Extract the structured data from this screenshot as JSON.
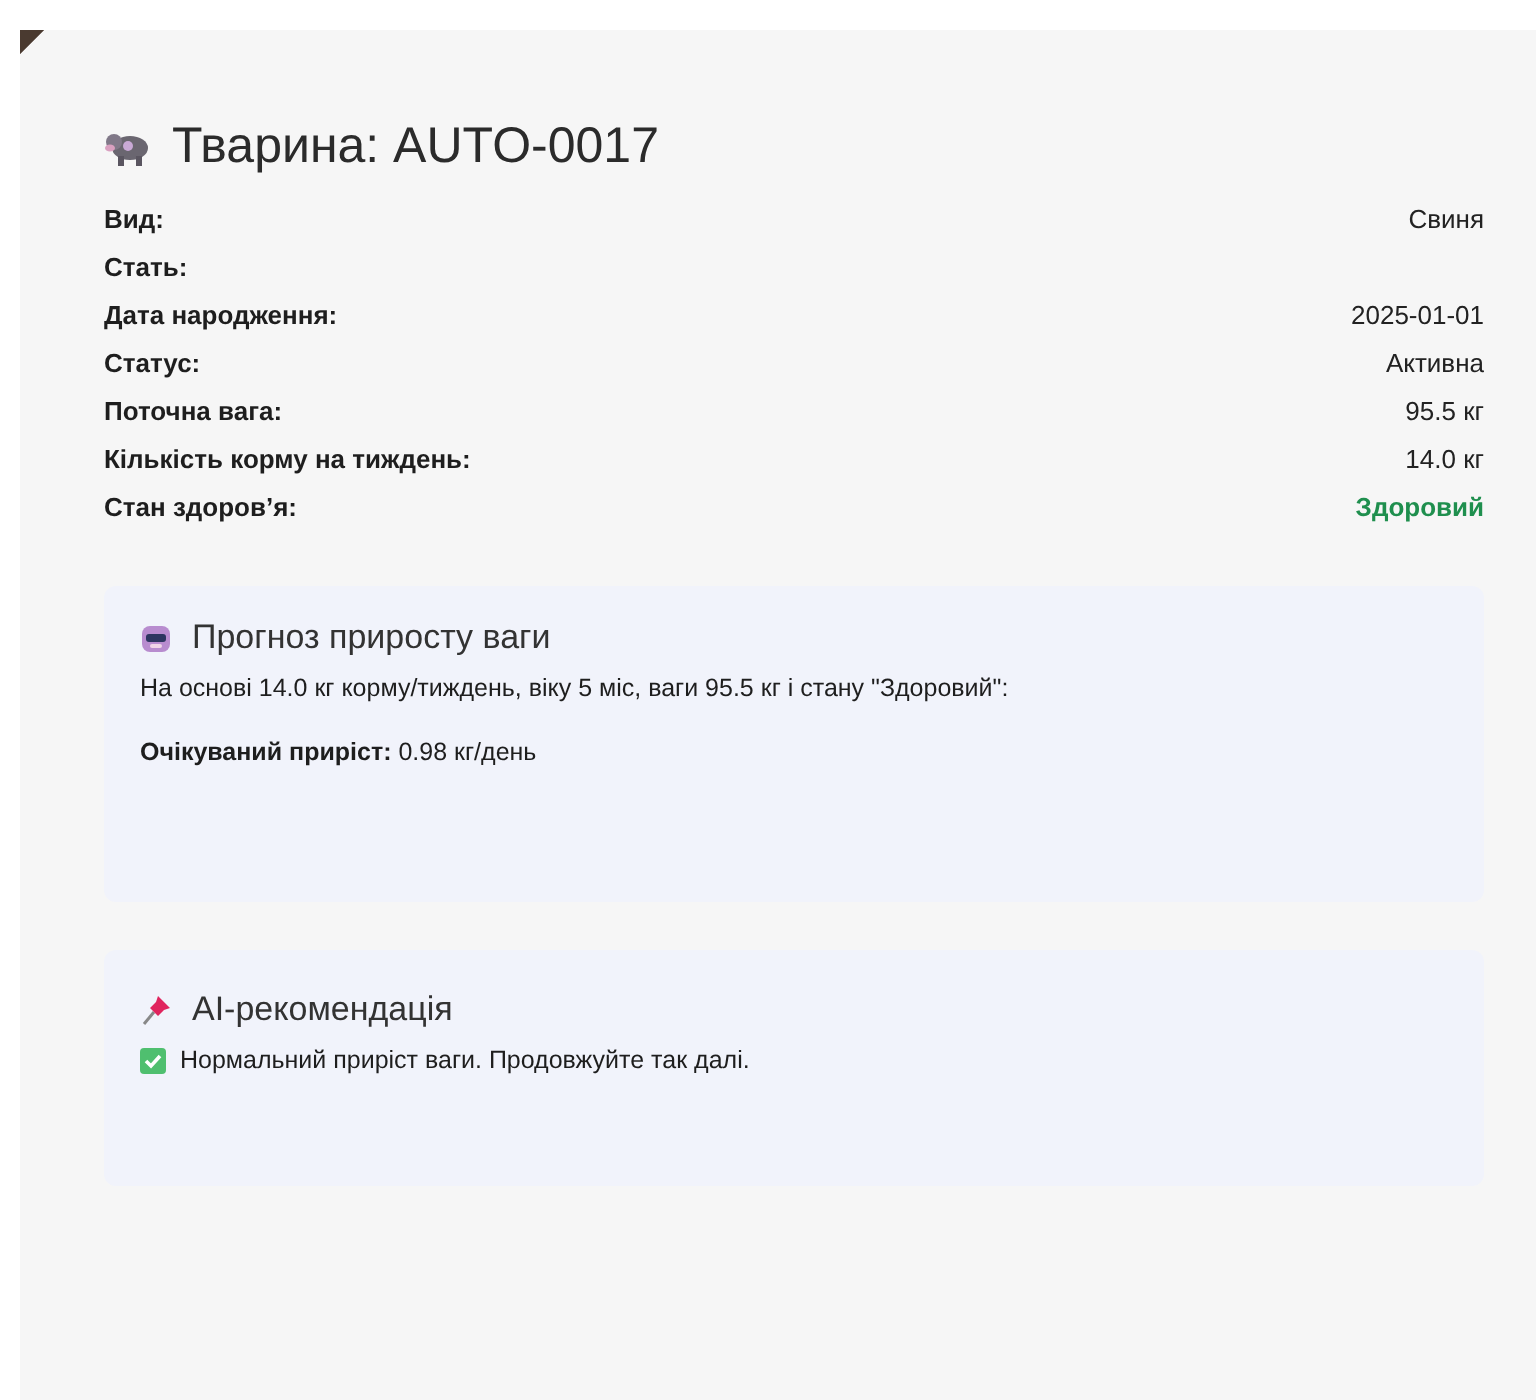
{
  "title": "Тварина: AUTO-0017",
  "details": [
    {
      "label": "Вид:",
      "value": "Свиня",
      "kind": "plain"
    },
    {
      "label": "Стать:"
    },
    {
      "label": "Дата народження:",
      "value": "2025-01-01",
      "kind": "plain"
    },
    {
      "label": "Статус:",
      "value": "Активна",
      "kind": "plain"
    },
    {
      "label": "Поточна вага:",
      "value": "95.5 кг",
      "kind": "plain"
    },
    {
      "label": "Кількість корму на тиждень:",
      "value": "14.0 кг",
      "kind": "plain"
    },
    {
      "label": "Стан здоров’я:",
      "value": "Здоровий",
      "kind": "good"
    }
  ],
  "forecast": {
    "title": "Прогноз приросту ваги",
    "basis": "На основі 14.0 кг корму/тиждень, віку 5 міс, ваги 95.5 кг і стану \"Здоровий\":",
    "result": "**Очікуваний приріст:** 0.98 кг/день"
  },
  "recommendation": {
    "title": "AI-рекомендація",
    "text": "Нормальний приріст ваги. Продовжуйте так далі."
  }
}
